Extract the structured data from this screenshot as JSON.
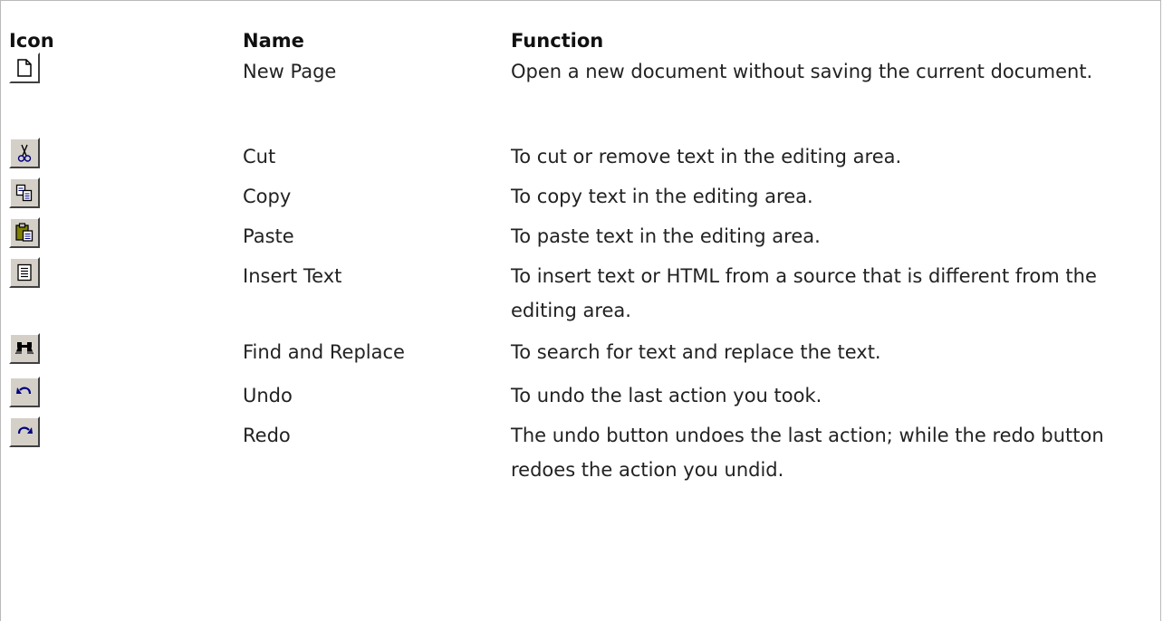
{
  "table": {
    "headers": {
      "icon": "Icon",
      "name": "Name",
      "function": "Function"
    },
    "rows": [
      {
        "icon": "new-page-icon",
        "name": "New Page",
        "function": "Open a new document without saving the current document."
      },
      {
        "icon": "cut-icon",
        "name": "Cut",
        "function": "To cut or remove text in the editing area."
      },
      {
        "icon": "copy-icon",
        "name": "Copy",
        "function": "To copy text in the editing area."
      },
      {
        "icon": "paste-icon",
        "name": "Paste",
        "function": "To paste text in the editing area."
      },
      {
        "icon": "insert-text-icon",
        "name": "Insert Text",
        "function": "To insert text or HTML from a source that is different from the editing area."
      },
      {
        "icon": "find-replace-icon",
        "name": "Find and Replace",
        "function": "To search for text and replace the text."
      },
      {
        "icon": "undo-icon",
        "name": "Undo",
        "function": "To undo the last action you took."
      },
      {
        "icon": "redo-icon",
        "name": "Redo",
        "function": "The undo button undoes the last action; while the redo button redoes the action you undid."
      }
    ]
  },
  "colors": {
    "button_face": "#d4d0c8",
    "frame_border": "#b9b9b9",
    "text": "#222222"
  }
}
